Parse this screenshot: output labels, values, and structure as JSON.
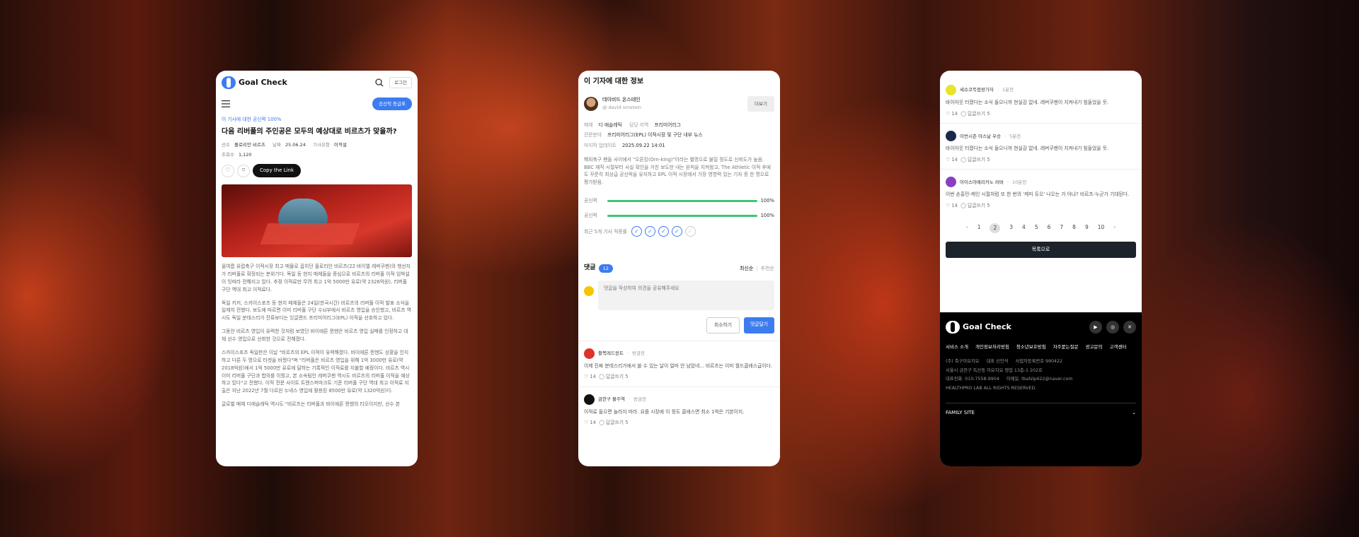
{
  "phone1": {
    "logo_text": "Goal Check",
    "login_label": "로그인",
    "grade_button": "공신력 등급표",
    "credibility_tag": "이 기사에 대한 공신력 100%",
    "headline": "다음 리버풀의 주인공은 모두의 예상대로 비르츠가 맞을까?",
    "meta1": {
      "player_label": "선수",
      "player": "플로리안 비르츠",
      "date_label": "날짜",
      "date": "25.06.24",
      "type_label": "기사유형",
      "type": "이적설"
    },
    "meta2": {
      "views_label": "조회수",
      "views": "1,120"
    },
    "copy_link": "Copy the Link",
    "paragraphs": [
      "올여름 유럽축구 이적시장 최고 매물로 꼽히던 플로리안 비르츠(22·바이엘 레버쿠젠)의 행선지가 리버풀로 확정되는 분위기다. 독일 등 현지 매체들을 중심으로 비르츠의 리버풀 이적 임박설이 잇따라 전해지고 있다. 추정 이적료만 무려 최고 1억 5000만 유로(약 2326억원), 리버풀 구단 역대 최고 이적료다.",
      "독일 키커, 스카이스포츠 등 현지 매체들은 24일(한국시간) 비르츠의 리버풀 이적 발표 소식을 일제히 전했다. 보도에 따르면 이미 리버풀 구단 수뇌부에서 비르츠 영입을 승인했고, 비르츠 역시도 독일 분데스리가 잔류보다는 잉글랜드 프리미어리그(EPL) 이적을 선호하고 있다.",
      "그동안 비르츠 영입이 유력한 것처럼 보였던 바이에른 뮌헨은 비르츠 영입 실패를 인정하고 대체 선수 영입으로 선회한 것으로 전해졌다.",
      "스카이스포츠 독일판은 이날 \"비르츠의 EPL 이적이 유력해졌다. 바이에른 뮌헨도 상황을 인지하고 다른 두 명으로 타겟을 바꿨다\"며 \"리버풀은 비르츠 영입을 위해 1억 3000만 유로(약 2018억원)에서 1억 5000만 유로에 달하는 기록적인 이적료를 지불할 예정이다. 비르츠 역시 이미 리버풀 구단과 합의를 이뤘고, 본 소속팀인 레버쿠젠 역시도 비르츠의 리버풀 이적을 예상하고 있다\"고 전했다. 이적 전문 사이트 트랜스퍼마크트 기준 리버풀 구단 역대 최고 이적료 지출은 지난 2022년 7월 다르윈 누녜스 영입에 활용된 8500만 유로(약 1320억원)다.",
      "글로벌 매체 디애슬레틱 역시도 \"비르츠는 리버풀과 바이에른 뮌헨의 타오이지만, 선수 본"
    ]
  },
  "phone2": {
    "section_title": "이 기자에 대한 정보",
    "reporter_name": "데이비드 온스테인",
    "reporter_handle": "@ david ornstein",
    "follow_label": "더보기",
    "media_label": "매체",
    "media": "디 애슬레틱",
    "area_label": "담당 지역",
    "area": "프리미어리그",
    "field_label": "전문분야",
    "field": "프리미어리그(EPL) 이적시장 및 구단 내부 뉴스",
    "update_label": "마지막 업데이트",
    "update": "2025.09.22 14:01",
    "bio": "해외축구 팬들 사이에서 \"오른킹(Orn-king)\"이라는 별명으로 불릴 정도로 신뢰도가 높음. BBC 재직 시절부터 사실 확인을 거친 보도만 내는 원칙을 지켜왔고, The Athletic 이적 후에도 꾸준히 최상급 공신력을 유지하고 EPL 이적 시장에서 가장 영향력 있는 기자 중 한 명으로 평가받음.",
    "bars": [
      {
        "label": "공신력",
        "value": 100,
        "value_text": "100%"
      },
      {
        "label": "공신력",
        "value": 100,
        "value_text": "100%"
      }
    ],
    "recent_label": "최근 5개 기사 적중률",
    "recent_hits": [
      true,
      true,
      true,
      true,
      false
    ],
    "comments_title": "댓글",
    "comments_count": "12",
    "sort_latest": "최신순",
    "sort_recommend": "추천순",
    "comment_placeholder": "댓글을 작성하여 의견을 공유해주세요",
    "cancel_label": "취소하기",
    "submit_label": "댓글달기",
    "comments": [
      {
        "user": "활쪽레드윈트",
        "time": "방금전",
        "text": "이제 진짜 분데스리가에서 볼 수 있는 날이 얼마 안 남았네... 비르츠는 이미 월드클래스급이다.",
        "likes": "14",
        "reply": "답글쓰기 5",
        "avatar_color": "#e0312a"
      },
      {
        "user": "금한구 불주역",
        "time": "방금전",
        "text": "이적료 들으면 놀라지 마라. 요즘 시장에 이 정도 클래스면 최소 1억은 기본이지.",
        "likes": "14",
        "reply": "답글쓰기 5",
        "avatar_color": "#111111"
      }
    ]
  },
  "phone3": {
    "comments": [
      {
        "user": "세슈코득점왕가자",
        "time": "1분전",
        "text": "바이아웃 터졌다는 소식 들으니까 현실감 없네. 레버쿠젠이 지켜내기 힘들었을 듯.",
        "likes": "14",
        "reply": "답글쓰기 5",
        "avatar_color": "#e9e32a"
      },
      {
        "user": "이번시즌 아스날 우승",
        "time": "5분전",
        "text": "바이아웃 터졌다는 소식 들으니까 현실감 없네. 레버쿠젠이 지켜내기 힘들었을 듯.",
        "likes": "14",
        "reply": "답글쓰기 5",
        "avatar_color": "#1a2a4a"
      },
      {
        "user": "아이스아메리카노 러버",
        "time": "10분전",
        "text": "이번 손흥민-케인 시절처럼 또 한 번의 '케미 듀오' 나오는 거 아냐? 비르츠-누군가 기대된다.",
        "likes": "14",
        "reply": "답글쓰기 5",
        "avatar_color": "#8a3fc0"
      }
    ],
    "pages": [
      "1",
      "2",
      "3",
      "4",
      "5",
      "6",
      "7",
      "8",
      "9",
      "10"
    ],
    "current_page": "2",
    "list_button": "목록으로",
    "footer": {
      "logo_text": "Goal Check",
      "links": [
        "서비스 소개",
        "개인정보처리방침",
        "청소년보호방침",
        "자주묻는질문",
        "광고문의",
        "고객센터"
      ],
      "company": "(주) 축구이요지요     대표 신민석     사업자등록번호 990422",
      "address": "서울시 금천구 독산동 이요지요 영업 13층-1 202호",
      "contact": "대표전화. 010-7558-9904     이메일. tbalslp422@naver.com",
      "copyright": "HEALTHPRO LAB ALL RIGHTS RESERVED.",
      "family_site": "FAMILY SITE"
    }
  }
}
